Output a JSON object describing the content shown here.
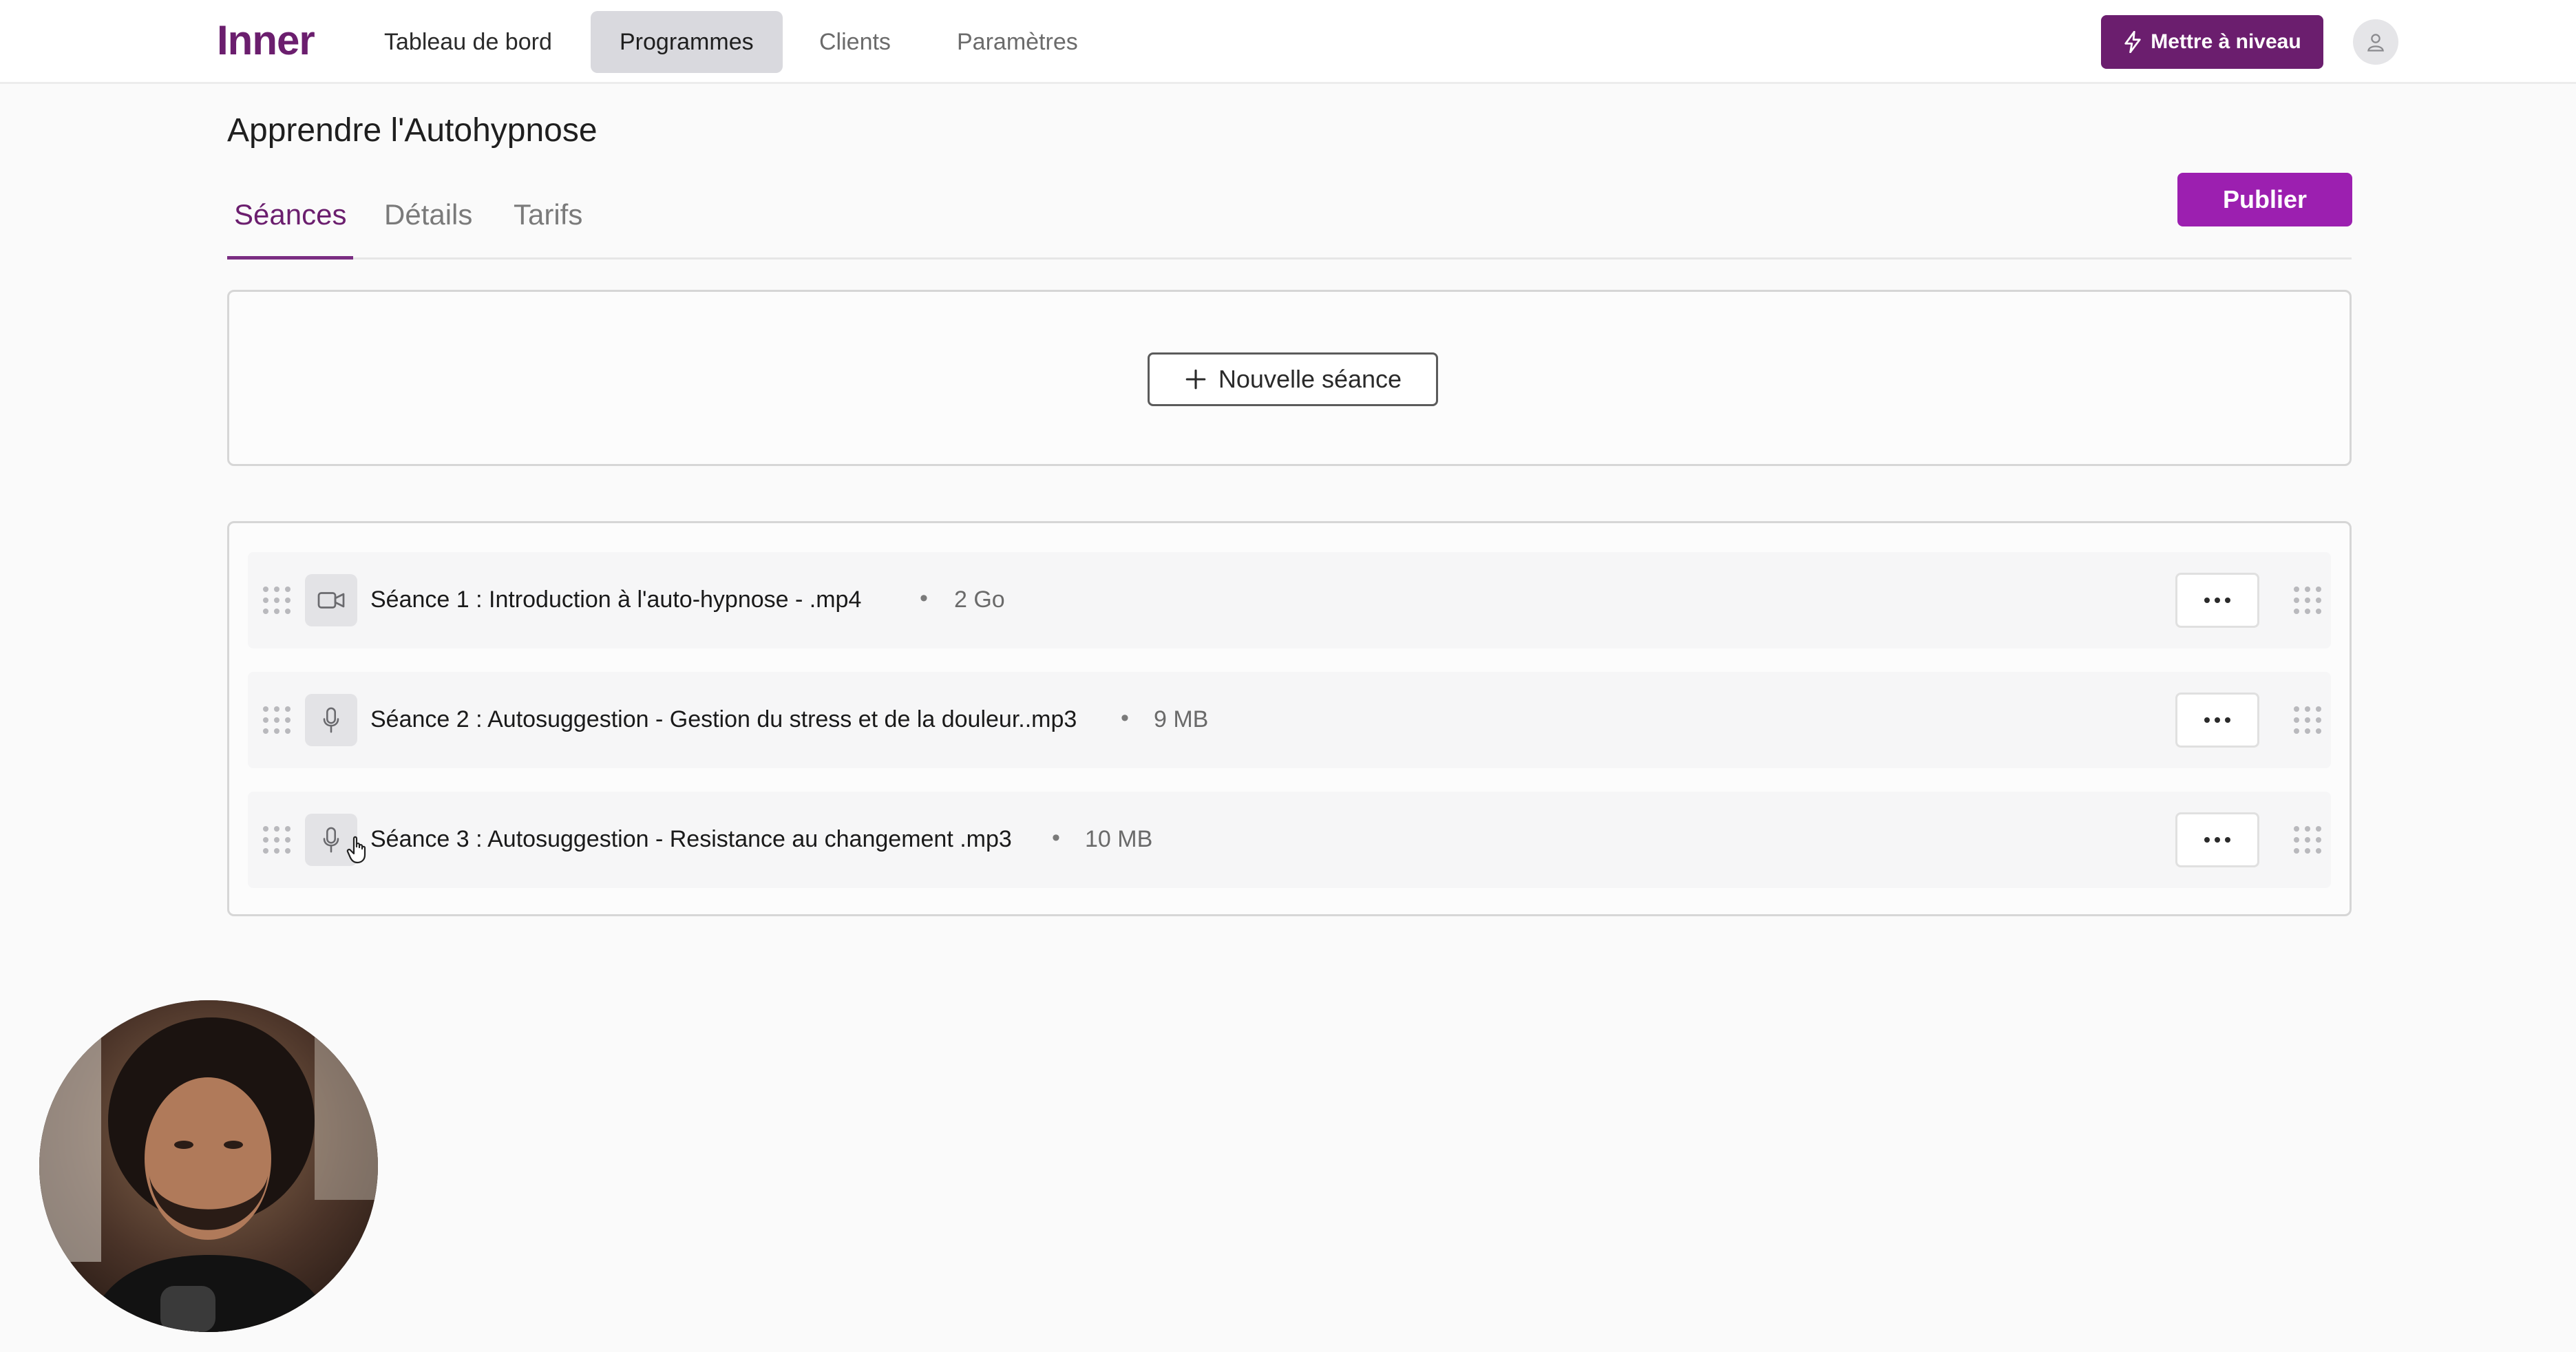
{
  "nav": {
    "logo": "Inner",
    "items": [
      "Tableau de bord",
      "Programmes",
      "Clients",
      "Paramètres"
    ],
    "active": "Programmes",
    "upgrade_label": "Mettre à niveau"
  },
  "page": {
    "title": "Apprendre l'Autohypnose",
    "tabs": [
      "Séances",
      "Détails",
      "Tarifs"
    ],
    "active_tab": "Séances",
    "publish_label": "Publier"
  },
  "new_session": {
    "label": "Nouvelle séance"
  },
  "sessions": [
    {
      "name": "Séance 1 : Introduction à l'auto-hypnose - .mp4",
      "size": "2 Go",
      "type_icon": "video-camera-icon"
    },
    {
      "name": "Séance 2 : Autosuggestion - Gestion du stress et de la douleur..mp3",
      "size": "9 MB",
      "type_icon": "microphone-icon"
    },
    {
      "name": "Séance 3 : Autosuggestion - Resistance au changement .mp3",
      "size": "10 MB",
      "type_icon": "microphone-icon"
    }
  ],
  "colors": {
    "brand": "#6b1e6e",
    "publish": "#9c1fb0",
    "nav_active_bg": "#d9d9de"
  }
}
